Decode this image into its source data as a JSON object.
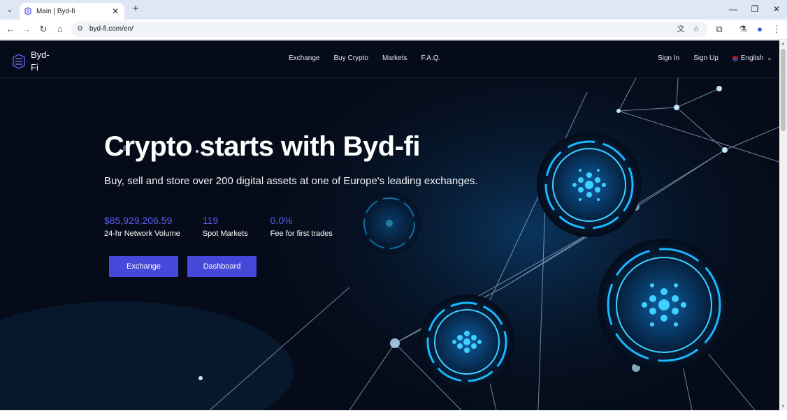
{
  "browser": {
    "tab_title": "Main | Byd-fi",
    "url": "byd-fi.com/en/",
    "icons": {
      "tab_dropdown": "chevron-down-icon",
      "favicon": "byd-fi-logo-icon",
      "tab_close": "close-icon",
      "new_tab": "plus-icon",
      "minimize": "minimize-icon",
      "maximize": "restore-icon",
      "close_window": "close-icon",
      "back": "arrow-left-icon",
      "forward": "arrow-right-icon",
      "reload": "reload-icon",
      "home": "home-icon",
      "site_info": "tune-icon",
      "translate": "translate-icon",
      "bookmark": "star-icon",
      "extensions": "puzzle-icon",
      "labs": "flask-icon",
      "profile": "profile-icon",
      "menu": "kebab-menu-icon"
    }
  },
  "site": {
    "logo_text": "Byd-Fi",
    "nav": {
      "links": [
        "Exchange",
        "Buy Crypto",
        "Markets",
        "F.A.Q."
      ],
      "sign_in": "Sign In",
      "sign_up": "Sign Up",
      "language": "English"
    },
    "hero": {
      "title": "Crypto starts with Byd-fi",
      "subtitle": "Buy, sell and store over 200 digital assets at one of Europe's leading exchanges.",
      "stats": [
        {
          "value": "$85,929,206.59",
          "label": "24-hr Network Volume"
        },
        {
          "value": "119",
          "label": "Spot Markets"
        },
        {
          "value": "0.0%",
          "label": "Fee for first trades"
        }
      ],
      "buttons": {
        "exchange": "Exchange",
        "dashboard": "Dashboard"
      }
    }
  },
  "colors": {
    "page_bg": "#050b18",
    "accent": "#4548d8",
    "stat_value": "#5b5ef0",
    "glow": "#19b8ff"
  }
}
